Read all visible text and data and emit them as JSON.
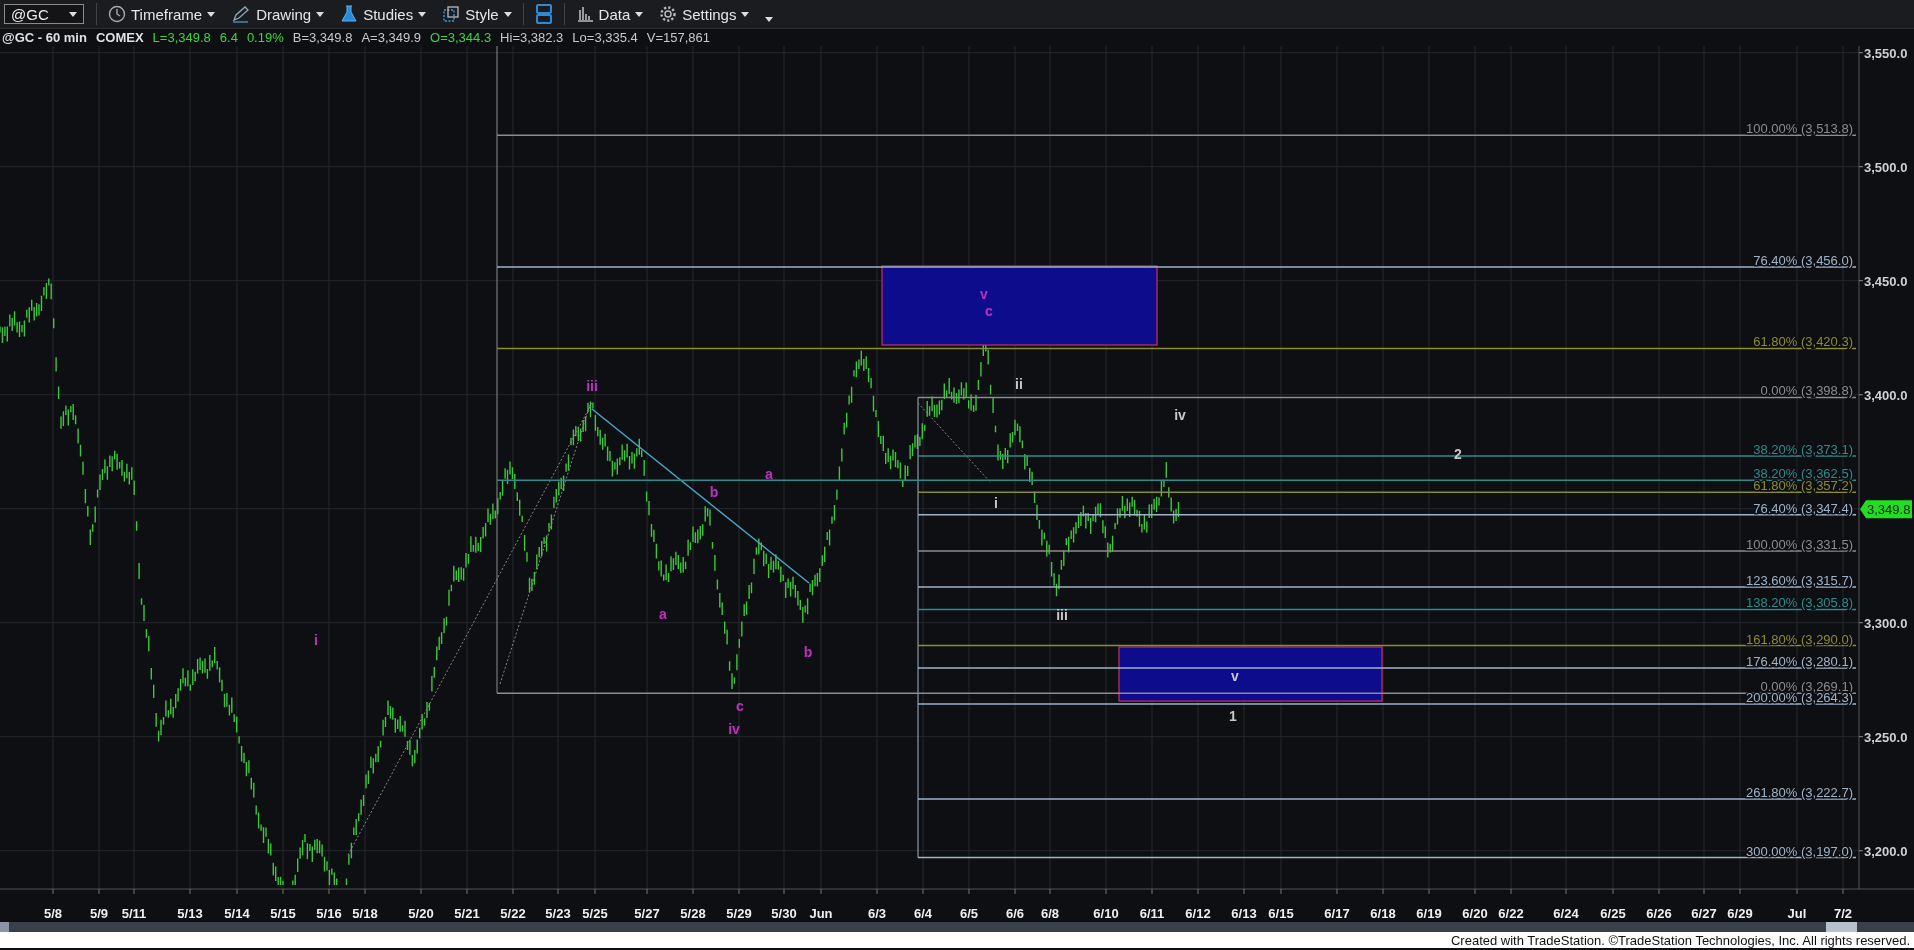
{
  "toolbar": {
    "symbol": "@GC",
    "items": [
      {
        "kind": "menu",
        "label": "Timeframe"
      },
      {
        "kind": "menu",
        "label": "Drawing"
      },
      {
        "kind": "menu",
        "label": "Studies"
      },
      {
        "kind": "menu",
        "label": "Style"
      },
      {
        "kind": "icon"
      },
      {
        "kind": "menu",
        "label": "Data"
      },
      {
        "kind": "menu",
        "label": "Settings"
      },
      {
        "kind": "caret"
      }
    ]
  },
  "info_bar": [
    {
      "text": "@GC - 60 min",
      "color": "#e0e0e0"
    },
    {
      "text": "COMEX",
      "color": "#e0e0e0"
    },
    {
      "text": "L=3,349.8",
      "color": "#3cd63c"
    },
    {
      "text": "6.4",
      "color": "#3cd63c"
    },
    {
      "text": "0.19%",
      "color": "#3cd63c"
    },
    {
      "text": "B=3,349.8",
      "color": "#c8c8c8"
    },
    {
      "text": "A=3,349.9",
      "color": "#c8c8c8"
    },
    {
      "text": "O=3,344.3",
      "color": "#3cd63c"
    },
    {
      "text": "Hi=3,382.3",
      "color": "#c8c8c8"
    },
    {
      "text": "Lo=3,335.4",
      "color": "#c8c8c8"
    },
    {
      "text": "V=157,861",
      "color": "#c8c8c8"
    }
  ],
  "chart": {
    "price_axis": [
      "3,550.0",
      "3,500.0",
      "3,450.0",
      "3,400.0",
      "3,300.0",
      "3,250.0",
      "3,200.0"
    ],
    "last_price": "3,349.8",
    "fib_levels": [
      {
        "label": "100.00% (3,513.8)",
        "color": "#8c8c8c"
      },
      {
        "label": "76.40% (3,456.0)",
        "color": "#9fb3c8"
      },
      {
        "label": "61.80% (3,420.3)",
        "color": "#8c8c30"
      },
      {
        "label": "0.00% (3,398.8)",
        "color": "#8c8c8c"
      },
      {
        "label": "38.20% (3,373.1)",
        "color": "#2e8c8c"
      },
      {
        "label": "38.20% (3,362.5)",
        "color": "#2e8c8c"
      },
      {
        "label": "61.80% (3,357.2)",
        "color": "#8c8c30"
      },
      {
        "label": "76.40% (3,347.4)",
        "color": "#9fb3c8"
      },
      {
        "label": "100.00% (3,331.5)",
        "color": "#8c8c8c"
      },
      {
        "label": "123.60% (3,315.7)",
        "color": "#9fb3c8"
      },
      {
        "label": "138.20% (3,305.8)",
        "color": "#2e8c8c"
      },
      {
        "label": "161.80% (3,290.0)",
        "color": "#8c8c30"
      },
      {
        "label": "176.40% (3,280.1)",
        "color": "#9fb3c8"
      },
      {
        "label": "0.00% (3,269.1)",
        "color": "#8c8c8c"
      },
      {
        "label": "200.00% (3,264.3)",
        "color": "#9fb3c8"
      },
      {
        "label": "261.80% (3,222.7)",
        "color": "#9fb3c8"
      },
      {
        "label": "300.00% (3,197.0)",
        "color": "#9fb3c8"
      }
    ],
    "wave_labels": [
      {
        "text": "i",
        "color": "#c030c0"
      },
      {
        "text": "iii",
        "color": "#c030c0"
      },
      {
        "text": "b",
        "color": "#c030c0"
      },
      {
        "text": "a",
        "color": "#c030c0"
      },
      {
        "text": "a",
        "color": "#c030c0"
      },
      {
        "text": "b",
        "color": "#c030c0"
      },
      {
        "text": "c",
        "color": "#c030c0"
      },
      {
        "text": "iv",
        "color": "#c030c0"
      },
      {
        "text": "v",
        "color": "#c030c0"
      },
      {
        "text": "c",
        "color": "#c030c0"
      },
      {
        "text": "ii",
        "color": "#c8c8c8"
      },
      {
        "text": "i",
        "color": "#c8c8c8"
      },
      {
        "text": "iii",
        "color": "#c8c8c8"
      },
      {
        "text": "iv",
        "color": "#c8c8c8"
      },
      {
        "text": "2",
        "color": "#c8c8c8"
      },
      {
        "text": "v",
        "color": "#c8c8c8"
      },
      {
        "text": "1",
        "color": "#c8c8c8"
      }
    ],
    "date_axis": [
      "5/8",
      "5/9",
      "5/11",
      "5/13",
      "5/14",
      "5/15",
      "5/16",
      "5/18",
      "5/20",
      "5/21",
      "5/22",
      "5/23",
      "5/25",
      "5/27",
      "5/28",
      "5/29",
      "5/30",
      "Jun",
      "6/3",
      "6/4",
      "6/5",
      "6/6",
      "6/8",
      "6/10",
      "6/11",
      "6/12",
      "6/13",
      "6/15",
      "6/17",
      "6/18",
      "6/19",
      "6/20",
      "6/22",
      "6/24",
      "6/25",
      "6/26",
      "6/27",
      "6/29",
      "Jul",
      "7/2"
    ]
  },
  "footer": "Created with TradeStation. ©TradeStation Technologies, Inc. All rights reserved."
}
